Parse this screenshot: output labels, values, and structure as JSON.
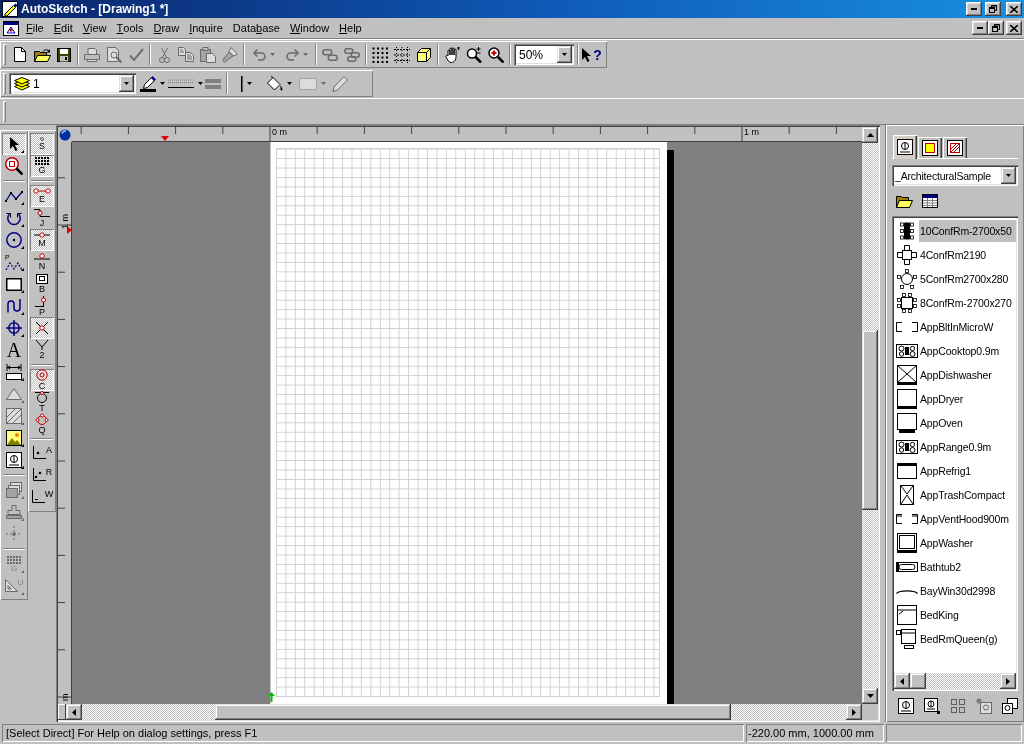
{
  "window": {
    "title": "AutoSketch - [Drawing1 *]"
  },
  "menu_bar": [
    {
      "key": "F",
      "post": "ile"
    },
    {
      "key": "E",
      "post": "dit"
    },
    {
      "key": "V",
      "post": "iew"
    },
    {
      "key": "T",
      "post": "ools"
    },
    {
      "key": "D",
      "post": "raw"
    },
    {
      "key": "I",
      "post": "nquire"
    },
    {
      "pre": "Data",
      "key": "b",
      "post": "ase"
    },
    {
      "key": "W",
      "post": "indow"
    },
    {
      "key": "H",
      "post": "elp"
    }
  ],
  "standard_toolbar": {
    "groups": [
      {
        "buttons": [
          {
            "kind": "new",
            "disabled": false,
            "dropdown": false
          },
          {
            "kind": "open",
            "disabled": false,
            "dropdown": false
          },
          {
            "kind": "save",
            "disabled": false,
            "dropdown": false
          }
        ]
      },
      {
        "buttons": [
          {
            "kind": "print",
            "disabled": true,
            "dropdown": false
          },
          {
            "kind": "preview",
            "disabled": true,
            "dropdown": false
          },
          {
            "kind": "spelling",
            "disabled": true,
            "dropdown": false
          }
        ]
      },
      {
        "buttons": [
          {
            "kind": "cut",
            "disabled": true,
            "dropdown": false
          },
          {
            "kind": "copy",
            "disabled": true,
            "dropdown": false
          },
          {
            "kind": "paste",
            "disabled": true,
            "dropdown": false
          },
          {
            "kind": "painter",
            "disabled": true,
            "dropdown": false
          }
        ]
      },
      {
        "buttons": [
          {
            "kind": "undo",
            "disabled": true,
            "dropdown": true
          },
          {
            "kind": "redo",
            "disabled": true,
            "dropdown": true
          }
        ]
      },
      {
        "buttons": [
          {
            "kind": "link",
            "disabled": true,
            "dropdown": false
          },
          {
            "kind": "unlink",
            "disabled": true,
            "dropdown": false
          }
        ]
      },
      {
        "buttons": [
          {
            "kind": "snapgrid",
            "disabled": false,
            "dropdown": false
          },
          {
            "kind": "gridlines",
            "disabled": false,
            "dropdown": false
          },
          {
            "kind": "cube",
            "disabled": false,
            "dropdown": false
          }
        ]
      },
      {
        "buttons": [
          {
            "kind": "pan",
            "disabled": false,
            "dropdown": false
          },
          {
            "kind": "zoomstep",
            "disabled": false,
            "dropdown": false
          },
          {
            "kind": "zoomin",
            "disabled": false,
            "dropdown": false
          }
        ]
      },
      {
        "buttons": [
          {
            "kind": "zoombox",
            "value": "50%",
            "disabled": false,
            "dropdown": true
          }
        ]
      },
      {
        "buttons": [
          {
            "kind": "help",
            "glyph": "?",
            "disabled": false,
            "dropdown": false
          }
        ]
      }
    ]
  },
  "property_toolbar": {
    "groups": [
      {
        "buttons": [
          {
            "kind": "layer",
            "value": "1",
            "disabled": false,
            "dropdown": true
          },
          {
            "kind": "pen",
            "disabled": false,
            "dropdown": true
          },
          {
            "kind": "linestyle",
            "disabled": false,
            "dropdown": true
          },
          {
            "kind": "weight",
            "disabled": false,
            "dropdown": false
          }
        ]
      },
      {
        "buttons": [
          {
            "kind": "linetype",
            "disabled": false,
            "dropdown": true
          },
          {
            "kind": "fill",
            "disabled": false,
            "dropdown": true
          },
          {
            "kind": "pattern",
            "disabled": true,
            "dropdown": true
          },
          {
            "kind": "edit",
            "disabled": true,
            "dropdown": false
          }
        ]
      }
    ]
  },
  "draw_toolbar": {
    "groups": [
      {
        "tools": [
          {
            "kind": "select",
            "pressed": true,
            "disabled": false,
            "flyout": true
          },
          {
            "kind": "zoom",
            "pressed": false,
            "disabled": false,
            "flyout": false
          }
        ]
      },
      {
        "tools": [
          {
            "kind": "polyline",
            "pressed": false,
            "disabled": false,
            "flyout": true
          },
          {
            "kind": "arc",
            "pressed": false,
            "disabled": false,
            "flyout": true
          },
          {
            "kind": "circle",
            "pressed": false,
            "disabled": false,
            "flyout": true
          },
          {
            "kind": "points",
            "label": "P",
            "pressed": false,
            "disabled": false,
            "flyout": true
          },
          {
            "kind": "rectangle",
            "pressed": false,
            "disabled": false,
            "flyout": true
          },
          {
            "kind": "curve",
            "pressed": false,
            "disabled": false,
            "flyout": true
          },
          {
            "kind": "crosshair",
            "pressed": false,
            "disabled": false,
            "flyout": true
          },
          {
            "kind": "text",
            "label": "A",
            "pressed": false,
            "disabled": false,
            "flyout": false
          },
          {
            "kind": "dimension",
            "pressed": false,
            "disabled": false,
            "flyout": true
          },
          {
            "kind": "triangle",
            "pressed": false,
            "disabled": true,
            "flyout": true
          },
          {
            "kind": "hatch",
            "pressed": false,
            "disabled": true,
            "flyout": true
          },
          {
            "kind": "image",
            "pressed": false,
            "disabled": false,
            "flyout": true
          },
          {
            "kind": "symbol",
            "pressed": false,
            "disabled": false,
            "flyout": true
          }
        ]
      },
      {
        "tools": [
          {
            "kind": "stack",
            "pressed": false,
            "disabled": true,
            "flyout": true
          },
          {
            "kind": "stamp",
            "pressed": false,
            "disabled": true,
            "flyout": true
          },
          {
            "kind": "crossdots",
            "pressed": false,
            "disabled": true,
            "flyout": false
          }
        ]
      },
      {
        "tools": [
          {
            "kind": "grid",
            "label": "G",
            "pressed": false,
            "disabled": true,
            "flyout": true
          },
          {
            "kind": "setsquare",
            "label": "U",
            "pressed": false,
            "disabled": true,
            "flyout": true
          }
        ]
      }
    ]
  },
  "snap_toolbar": {
    "groups": [
      {
        "tools": [
          {
            "kind": "snappoint",
            "label": "S",
            "pressed": true
          },
          {
            "kind": "snapgrid",
            "label": "G",
            "pressed": true
          }
        ]
      },
      {
        "tools": [
          {
            "kind": "endpoint",
            "label": "E",
            "pressed": true
          },
          {
            "kind": "junction",
            "label": "J",
            "pressed": false
          },
          {
            "kind": "midpoint",
            "label": "M",
            "pressed": true
          },
          {
            "kind": "nearest",
            "label": "N",
            "pressed": false
          },
          {
            "kind": "symbolpoint",
            "label": "B",
            "pressed": false
          },
          {
            "kind": "perpendicular",
            "label": "P",
            "pressed": false
          },
          {
            "kind": "intersection",
            "pressed": true
          },
          {
            "kind": "fork",
            "label": "2",
            "pressed": false
          }
        ]
      },
      {
        "tools": [
          {
            "kind": "center",
            "label": "C",
            "pressed": true
          },
          {
            "kind": "tangent",
            "label": "T",
            "pressed": false
          },
          {
            "kind": "quadrant",
            "label": "Q",
            "pressed": false
          }
        ]
      },
      {
        "tools": [
          {
            "kind": "absolute",
            "label": "A",
            "pressed": false
          },
          {
            "kind": "relative",
            "label": "R",
            "pressed": false
          },
          {
            "kind": "world",
            "label": "W",
            "pressed": false
          }
        ]
      }
    ]
  },
  "drawing": {
    "horizontal_ruler": {
      "labels": [
        "0 m",
        "1 m"
      ]
    },
    "vertical_ruler": {
      "labels": [
        "1 m",
        "m"
      ]
    }
  },
  "symbol_panel": {
    "tabs": [
      {
        "kind": "symbol",
        "selected": true
      },
      {
        "kind": "frame",
        "selected": false
      },
      {
        "kind": "hatch",
        "selected": false
      }
    ],
    "library": "_ArchitecturalSample",
    "symbols": [
      {
        "kind": "longtable",
        "label": "10ConfRm-2700x50",
        "selected": true
      },
      {
        "kind": "crosstable",
        "label": "4ConfRm2190",
        "selected": false
      },
      {
        "kind": "roundtable",
        "label": "5ConfRm2700x280",
        "selected": false
      },
      {
        "kind": "squaretable",
        "label": "8ConfRm-2700x270",
        "selected": false
      },
      {
        "kind": "bracket",
        "label": "AppBltInMicroW",
        "selected": false
      },
      {
        "kind": "cooktop",
        "label": "AppCooktop0.9m",
        "selected": false
      },
      {
        "kind": "dishwasher",
        "label": "AppDishwasher",
        "selected": false
      },
      {
        "kind": "dryer",
        "label": "AppDryer",
        "selected": false
      },
      {
        "kind": "oven",
        "label": "AppOven",
        "selected": false
      },
      {
        "kind": "range",
        "label": "AppRange0.9m",
        "selected": false
      },
      {
        "kind": "fridge",
        "label": "AppRefrig1",
        "selected": false
      },
      {
        "kind": "compactor",
        "label": "AppTrashCompact",
        "selected": false
      },
      {
        "kind": "hood",
        "label": "AppVentHood900m",
        "selected": false
      },
      {
        "kind": "washer",
        "label": "AppWasher",
        "selected": false
      },
      {
        "kind": "bathtub",
        "label": "Bathtub2",
        "selected": false
      },
      {
        "kind": "baywindow",
        "label": "BayWin30d2998",
        "selected": false
      },
      {
        "kind": "bed",
        "label": "BedKing",
        "selected": false
      },
      {
        "kind": "bedroom",
        "label": "BedRmQueen(g)",
        "selected": false
      }
    ],
    "tools": [
      {
        "kind": "insert",
        "disabled": false
      },
      {
        "kind": "place",
        "disabled": false
      },
      {
        "kind": "array",
        "disabled": false
      },
      {
        "kind": "explode",
        "disabled": true
      },
      {
        "kind": "library",
        "disabled": false
      }
    ]
  },
  "status_bar": {
    "message": "[Select Direct] For Help on dialog settings, press F1",
    "coordinates": "-220.00 mm, 1000.00 mm"
  }
}
